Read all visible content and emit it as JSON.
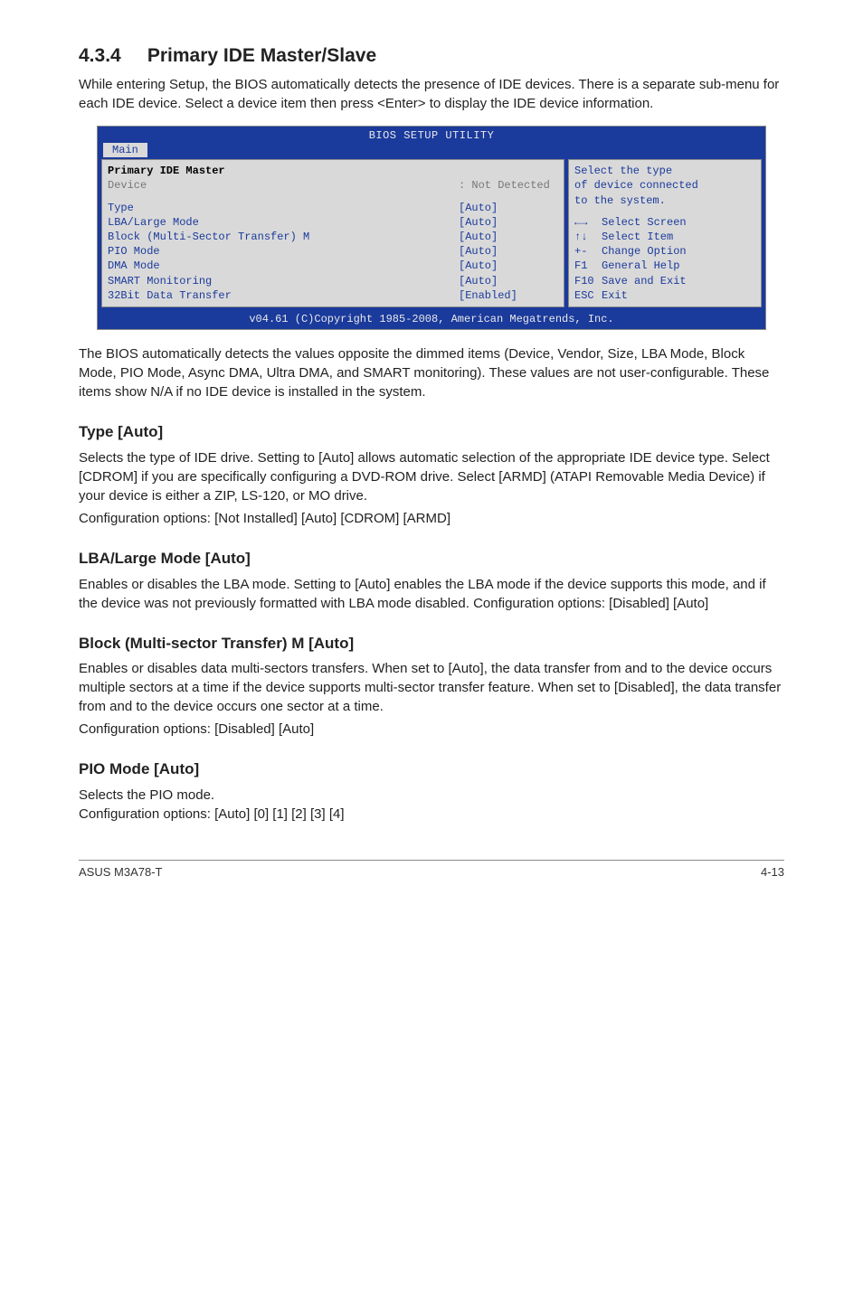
{
  "section": {
    "number": "4.3.4",
    "title": "Primary IDE Master/Slave"
  },
  "intro": "While entering Setup, the BIOS automatically detects the presence of IDE devices. There is a separate sub-menu for each IDE device. Select a device item then press <Enter> to display the IDE device information.",
  "bios": {
    "title": "BIOS SETUP UTILITY",
    "tab": "Main",
    "header": "Primary IDE Master",
    "device_label": "Device",
    "device_value": ": Not Detected",
    "items": [
      {
        "label": "Type",
        "value": "[Auto]"
      },
      {
        "label": "LBA/Large Mode",
        "value": "[Auto]"
      },
      {
        "label": "Block (Multi-Sector Transfer) M",
        "value": "[Auto]"
      },
      {
        "label": "PIO Mode",
        "value": "[Auto]"
      },
      {
        "label": "DMA Mode",
        "value": "[Auto]"
      },
      {
        "label": "SMART Monitoring",
        "value": "[Auto]"
      },
      {
        "label": "32Bit Data Transfer",
        "value": "[Enabled]"
      }
    ],
    "help_top1": "Select the type",
    "help_top2": "of device connected",
    "help_top3": "to the system.",
    "keys": {
      "k1": "Select Screen",
      "k2": "Select Item",
      "k3": "Change Option",
      "k4": "General Help",
      "k5": "Save and Exit",
      "k6": "Exit",
      "p1": "←→",
      "p2": "↑↓",
      "p3": "+-",
      "p4": "F1",
      "p5": "F10",
      "p6": "ESC"
    },
    "footer": "v04.61 (C)Copyright 1985-2008, American Megatrends, Inc."
  },
  "after_bios": "The BIOS automatically detects the values opposite the dimmed items (Device, Vendor, Size, LBA Mode, Block Mode, PIO Mode, Async DMA, Ultra DMA, and SMART monitoring). These values are not user-configurable. These items show N/A if no IDE device is installed in the system.",
  "type": {
    "heading": "Type [Auto]",
    "body1": "Selects the type of IDE drive. Setting to [Auto] allows automatic selection of the appropriate IDE device type. Select [CDROM] if you are specifically configuring a DVD-ROM drive. Select [ARMD] (ATAPI Removable Media Device) if your device is either a ZIP, LS-120, or MO drive.",
    "body2": "Configuration options: [Not Installed] [Auto] [CDROM] [ARMD]"
  },
  "lba": {
    "heading": "LBA/Large Mode [Auto]",
    "body": "Enables or disables the LBA mode. Setting to [Auto] enables the LBA mode if the device supports this mode, and if the device was not previously formatted with LBA mode disabled. Configuration options: [Disabled] [Auto]"
  },
  "block": {
    "heading": "Block (Multi-sector Transfer) M [Auto]",
    "body1": "Enables or disables data multi-sectors transfers. When set to [Auto], the data transfer from and to the device occurs multiple sectors at a time if the device supports multi-sector transfer feature. When set to [Disabled], the data transfer from and to the device occurs one sector at a time.",
    "body2": "Configuration options: [Disabled] [Auto]"
  },
  "pio": {
    "heading": "PIO Mode [Auto]",
    "body1": "Selects the PIO mode.",
    "body2": "Configuration options: [Auto] [0] [1] [2] [3] [4]"
  },
  "footer": {
    "left": "ASUS M3A78-T",
    "right": "4-13"
  }
}
